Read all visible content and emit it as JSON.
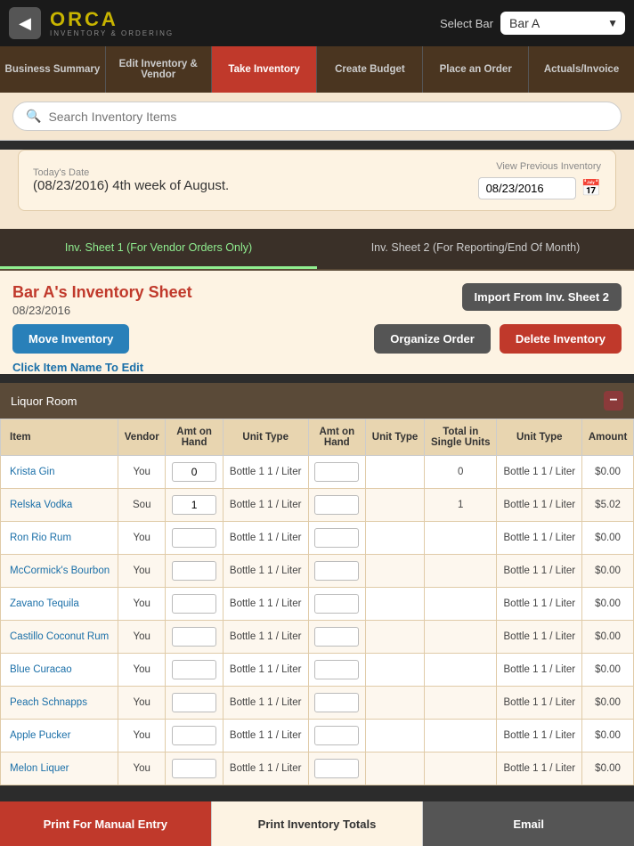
{
  "topbar": {
    "back_label": "◀",
    "logo": "ORCA",
    "logo_sub": "INVENTORY & ORDERING",
    "select_bar_label": "Select Bar",
    "bar_options": [
      "Bar A"
    ],
    "bar_selected": "Bar A"
  },
  "nav": {
    "tabs": [
      {
        "id": "business-summary",
        "label": "Business Summary",
        "active": false
      },
      {
        "id": "edit-inventory",
        "label": "Edit Inventory & Vendor",
        "active": false
      },
      {
        "id": "take-inventory",
        "label": "Take Inventory",
        "active": true
      },
      {
        "id": "create-budget",
        "label": "Create Budget",
        "active": false
      },
      {
        "id": "place-order",
        "label": "Place an Order",
        "active": false
      },
      {
        "id": "actuals-invoice",
        "label": "Actuals/Invoice",
        "active": false
      }
    ]
  },
  "search": {
    "placeholder": "Search Inventory Items"
  },
  "date_section": {
    "today_label": "Today's Date",
    "today_value": "(08/23/2016) 4th week of August.",
    "view_prev_label": "View Previous Inventory",
    "prev_date_value": "08/23/2016"
  },
  "sheet_tabs": [
    {
      "label": "Inv. Sheet 1 (For Vendor Orders Only)",
      "active": true
    },
    {
      "label": "Inv. Sheet 2 (For Reporting/End Of Month)",
      "active": false
    }
  ],
  "inventory": {
    "title": "Bar A's Inventory Sheet",
    "date": "08/23/2016",
    "import_btn": "Import From Inv. Sheet 2",
    "move_btn": "Move Inventory",
    "organize_btn": "Organize Order",
    "delete_btn": "Delete Inventory",
    "click_edit": "Click Item Name To Edit",
    "rooms": [
      {
        "name": "Liquor Room",
        "items": [
          {
            "name": "Krista Gin",
            "vendor": "You",
            "amt_on_hand": "0",
            "unit_type1": "Bottle 1 1 / Liter",
            "amt_on_hand2": "",
            "unit_type2": "",
            "total_single": "0",
            "unit_type3": "Bottle 1 1 / Liter",
            "amount": "$0.00"
          },
          {
            "name": "Relska Vodka",
            "vendor": "Sou",
            "amt_on_hand": "1",
            "unit_type1": "Bottle 1 1 / Liter",
            "amt_on_hand2": "",
            "unit_type2": "",
            "total_single": "1",
            "unit_type3": "Bottle 1 1 / Liter",
            "amount": "$5.02"
          },
          {
            "name": "Ron Rio Rum",
            "vendor": "You",
            "amt_on_hand": "",
            "unit_type1": "Bottle 1 1 / Liter",
            "amt_on_hand2": "",
            "unit_type2": "",
            "total_single": "",
            "unit_type3": "Bottle 1 1 / Liter",
            "amount": "$0.00"
          },
          {
            "name": "McCormick's Bourbon",
            "vendor": "You",
            "amt_on_hand": "",
            "unit_type1": "Bottle 1 1 / Liter",
            "amt_on_hand2": "",
            "unit_type2": "",
            "total_single": "",
            "unit_type3": "Bottle 1 1 / Liter",
            "amount": "$0.00"
          },
          {
            "name": "Zavano Tequila",
            "vendor": "You",
            "amt_on_hand": "",
            "unit_type1": "Bottle 1 1 / Liter",
            "amt_on_hand2": "",
            "unit_type2": "",
            "total_single": "",
            "unit_type3": "Bottle 1 1 / Liter",
            "amount": "$0.00"
          },
          {
            "name": "Castillo Coconut Rum",
            "vendor": "You",
            "amt_on_hand": "",
            "unit_type1": "Bottle 1 1 / Liter",
            "amt_on_hand2": "",
            "unit_type2": "",
            "total_single": "",
            "unit_type3": "Bottle 1 1 / Liter",
            "amount": "$0.00"
          },
          {
            "name": "Blue Curacao",
            "vendor": "You",
            "amt_on_hand": "",
            "unit_type1": "Bottle 1 1 / Liter",
            "amt_on_hand2": "",
            "unit_type2": "",
            "total_single": "",
            "unit_type3": "Bottle 1 1 / Liter",
            "amount": "$0.00"
          },
          {
            "name": "Peach Schnapps",
            "vendor": "You",
            "amt_on_hand": "",
            "unit_type1": "Bottle 1 1 / Liter",
            "amt_on_hand2": "",
            "unit_type2": "",
            "total_single": "",
            "unit_type3": "Bottle 1 1 / Liter",
            "amount": "$0.00"
          },
          {
            "name": "Apple Pucker",
            "vendor": "You",
            "amt_on_hand": "",
            "unit_type1": "Bottle 1 1 / Liter",
            "amt_on_hand2": "",
            "unit_type2": "",
            "total_single": "",
            "unit_type3": "Bottle 1 1 / Liter",
            "amount": "$0.00"
          },
          {
            "name": "Melon Liquer",
            "vendor": "You",
            "amt_on_hand": "",
            "unit_type1": "Bottle 1 1 / Liter",
            "amt_on_hand2": "",
            "unit_type2": "",
            "total_single": "",
            "unit_type3": "Bottle 1 1 / Liter",
            "amount": "$0.00"
          }
        ]
      }
    ],
    "table_headers": [
      "Item",
      "Vendor",
      "Amt on Hand",
      "Unit Type",
      "Amt on Hand",
      "Unit Type",
      "Total in Single Units",
      "Unit Type",
      "Amount"
    ]
  },
  "bottom_bar": {
    "print_manual": "Print For Manual Entry",
    "print_totals": "Print Inventory Totals",
    "email": "Email"
  }
}
